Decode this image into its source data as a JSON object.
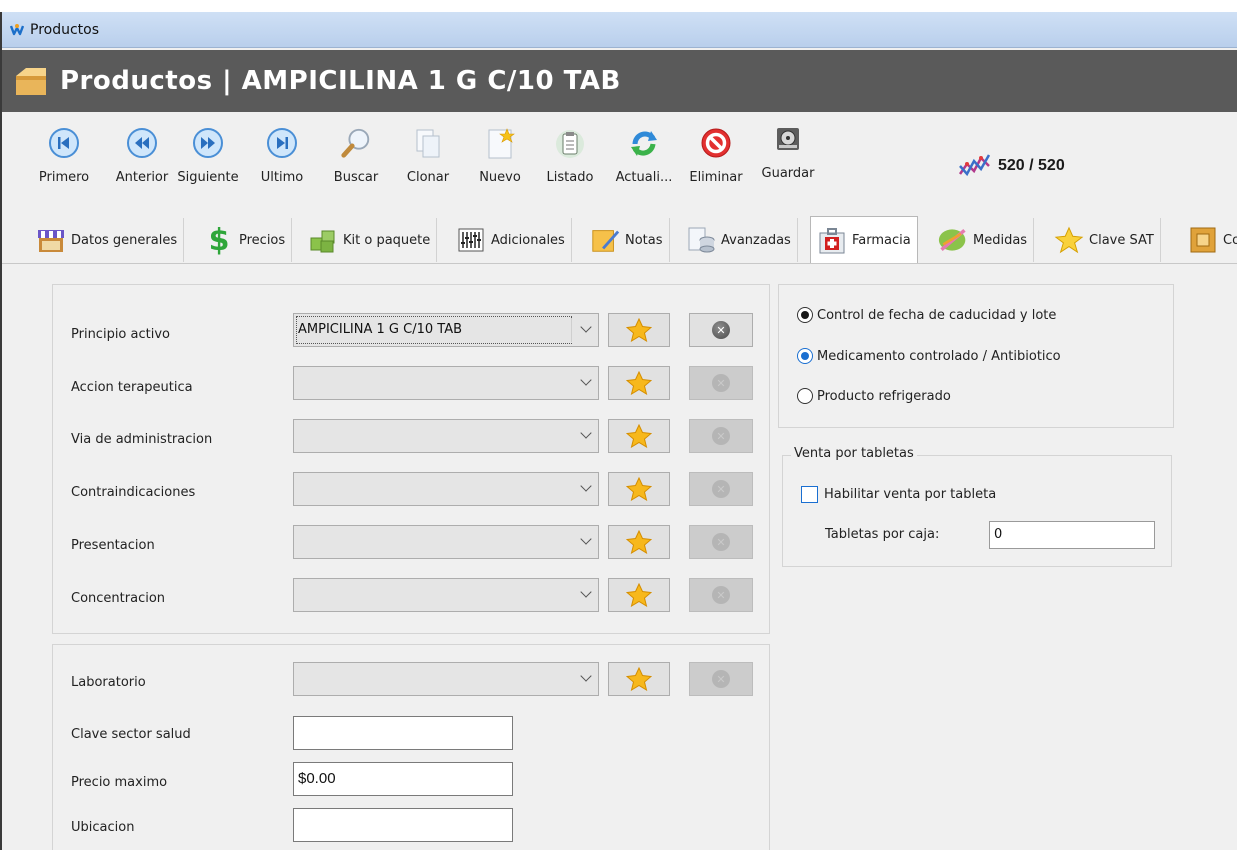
{
  "window": {
    "title": "Productos"
  },
  "header": {
    "title": "Productos | AMPICILINA 1 G C/10 TAB"
  },
  "toolbar": {
    "buttons": [
      {
        "id": "primero",
        "label": "Primero",
        "icon": "first-icon"
      },
      {
        "id": "anterior",
        "label": "Anterior",
        "icon": "previous-icon"
      },
      {
        "id": "siguiente",
        "label": "Siguiente",
        "icon": "next-icon"
      },
      {
        "id": "ultimo",
        "label": "Ultimo",
        "icon": "last-icon"
      },
      {
        "id": "buscar",
        "label": "Buscar",
        "icon": "magnifier-icon"
      },
      {
        "id": "clonar",
        "label": "Clonar",
        "icon": "copy-icon"
      },
      {
        "id": "nuevo",
        "label": "Nuevo",
        "icon": "new-document-icon"
      },
      {
        "id": "listado",
        "label": "Listado",
        "icon": "clipboard-list-icon"
      },
      {
        "id": "actualizar",
        "label": "Actuali...",
        "icon": "refresh-icon"
      },
      {
        "id": "eliminar",
        "label": "Eliminar",
        "icon": "delete-icon"
      },
      {
        "id": "guardar",
        "label": "Guardar",
        "icon": "hard-disk-icon"
      }
    ],
    "record_counter": "520 / 520"
  },
  "tabs": [
    {
      "label": "Datos generales",
      "icon": "store-icon"
    },
    {
      "label": "Precios",
      "icon": "dollar-icon"
    },
    {
      "label": "Kit o paquete",
      "icon": "cubes-icon"
    },
    {
      "label": "Adicionales",
      "icon": "sliders-icon"
    },
    {
      "label": "Notas",
      "icon": "notepad-icon"
    },
    {
      "label": "Avanzadas",
      "icon": "database-icon"
    },
    {
      "label": "Farmacia",
      "icon": "first-aid-kit-icon",
      "active": true
    },
    {
      "label": "Medidas",
      "icon": "ruler-icon"
    },
    {
      "label": "Clave SAT",
      "icon": "star-icon"
    },
    {
      "label": "Co",
      "icon": "box-icon"
    }
  ],
  "farmacia": {
    "fields": [
      {
        "label": "Principio activo",
        "value": "AMPICILINA 1 G C/10 TAB",
        "delete_enabled": true
      },
      {
        "label": "Accion terapeutica",
        "value": "",
        "delete_enabled": false
      },
      {
        "label": "Via de administracion",
        "value": "",
        "delete_enabled": false
      },
      {
        "label": "Contraindicaciones",
        "value": "",
        "delete_enabled": false
      },
      {
        "label": "Presentacion",
        "value": "",
        "delete_enabled": false
      },
      {
        "label": "Concentracion",
        "value": "",
        "delete_enabled": false
      }
    ],
    "laboratorio": {
      "label": "Laboratorio",
      "value": ""
    },
    "clave_sector_salud": {
      "label": "Clave sector salud",
      "value": ""
    },
    "precio_maximo": {
      "label": "Precio maximo",
      "value": "$0.00"
    },
    "ubicacion": {
      "label": "Ubicacion",
      "value": ""
    },
    "options": [
      {
        "label": "Control de fecha de caducidad y lote",
        "selected": true,
        "style": "dark"
      },
      {
        "label": "Medicamento controlado / Antibiotico",
        "selected": true,
        "style": "blue"
      },
      {
        "label": "Producto refrigerado",
        "selected": false
      }
    ],
    "venta_tabletas": {
      "legend": "Venta por tabletas",
      "checkbox_label": "Habilitar venta por tableta",
      "checked": false,
      "tabletas_label": "Tabletas por caja:",
      "tabletas_value": "0"
    }
  },
  "colors": {
    "header_bg": "#5a5a5a",
    "accent_blue": "#1a6fd1",
    "star": "#f5b400"
  }
}
